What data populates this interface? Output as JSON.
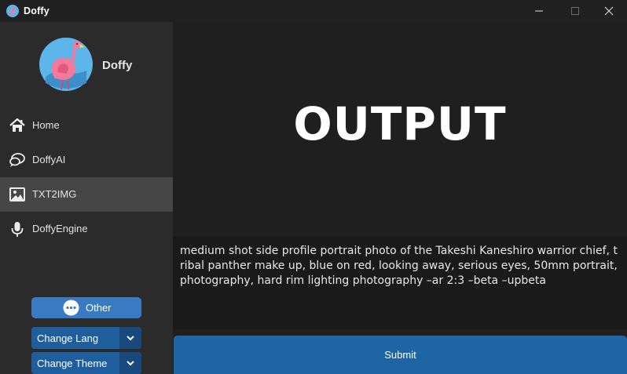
{
  "window": {
    "title": "Doffy"
  },
  "sidebar": {
    "app_name": "Doffy",
    "items": [
      {
        "label": "Home",
        "icon": "home-icon"
      },
      {
        "label": "DoffyAI",
        "icon": "chat-icon"
      },
      {
        "label": "TXT2IMG",
        "icon": "image-icon",
        "active": true
      },
      {
        "label": "DoffyEngine",
        "icon": "microphone-icon"
      }
    ],
    "other_label": "Other",
    "change_lang_label": "Change Lang",
    "change_theme_label": "Change Theme"
  },
  "main": {
    "output_title": "OUTPUT",
    "prompt_text": "medium shot side profile portrait photo of the Takeshi Kaneshiro warrior chief, tribal panther make up, blue on red, looking away, serious eyes, 50mm portrait, photography, hard rim lighting photography –ar 2:3 –beta –upbeta",
    "submit_label": "Submit"
  },
  "colors": {
    "sidebar_bg": "#2b2b2b",
    "active_item_bg": "#464646",
    "accent_light": "#3a7ac3",
    "accent_dark": "#1f5e9d",
    "submit_bg": "#1e66a3"
  }
}
